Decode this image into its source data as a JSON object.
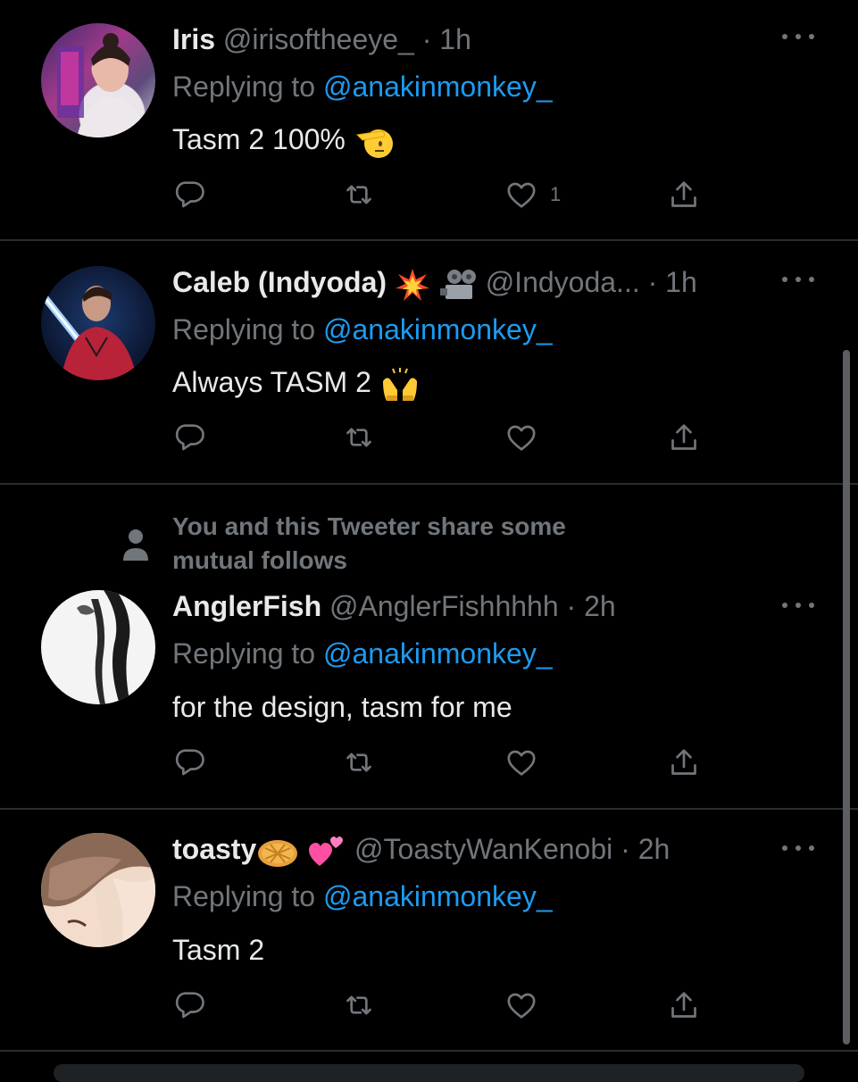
{
  "tweets": [
    {
      "name": "Iris",
      "handle": "@irisoftheeye_",
      "dot": "·",
      "time": "1h",
      "replying_prefix": "Replying to ",
      "replying_to": "@anakinmonkey_",
      "text": "Tasm 2 100%",
      "emoji_after_text": "saluting-face-emoji",
      "like_count": "1"
    },
    {
      "name": "Caleb (Indyoda)",
      "name_emojis": [
        "collision-emoji",
        "film-projector-emoji"
      ],
      "handle": "@Indyoda...",
      "dot": "·",
      "time": "1h",
      "replying_prefix": "Replying to ",
      "replying_to": "@anakinmonkey_",
      "text": "Always TASM 2",
      "emoji_after_text": "raising-hands-emoji"
    },
    {
      "context_line1": "You and this Tweeter share some",
      "context_line2": "mutual follows",
      "name": "AnglerFish",
      "handle": "@AnglerFishhhhh",
      "dot": "·",
      "time": "2h",
      "replying_prefix": "Replying to ",
      "replying_to": "@anakinmonkey_",
      "text": "for the design, tasm for me"
    },
    {
      "name": "toasty",
      "name_emojis": [
        "waffle-emoji",
        "two-hearts-emoji"
      ],
      "handle": "@ToastyWanKenobi",
      "dot": "·",
      "time": "2h",
      "replying_prefix": "Replying to ",
      "replying_to": "@anakinmonkey_",
      "text": "Tasm 2"
    }
  ],
  "icons": {
    "reply": "reply-icon",
    "retweet": "retweet-icon",
    "like": "heart-icon",
    "share": "share-icon",
    "more": "more-icon",
    "person": "person-icon"
  },
  "colors": {
    "background": "#000000",
    "text": "#e7e9ea",
    "secondary": "#71767b",
    "link": "#1d9bf0",
    "divider": "#2a2d30"
  }
}
